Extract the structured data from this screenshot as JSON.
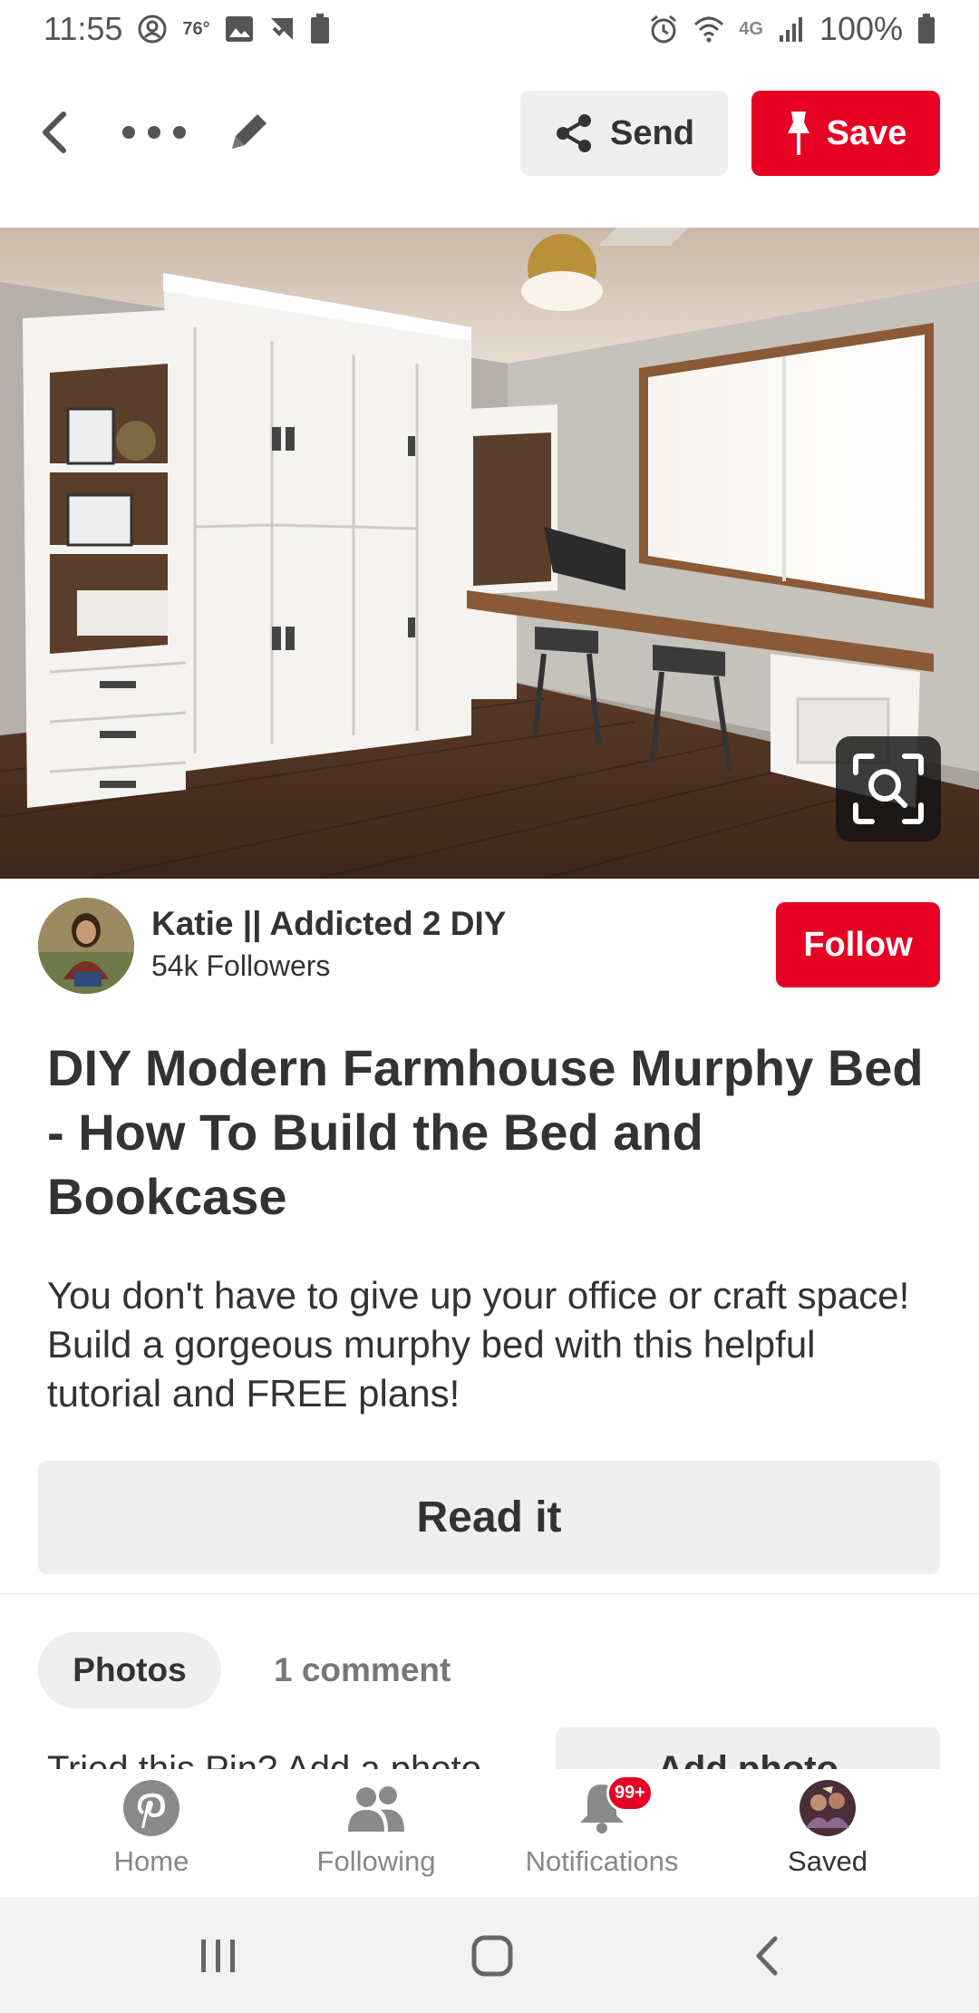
{
  "status_bar": {
    "time": "11:55",
    "temperature": "76°",
    "battery_small": "100",
    "network": "4G",
    "battery_percent": "100%"
  },
  "toolbar": {
    "send_label": "Send",
    "save_label": "Save"
  },
  "creator": {
    "name": "Katie || Addicted 2 DIY",
    "followers": "54k Followers",
    "follow_label": "Follow"
  },
  "pin": {
    "title": "DIY Modern Farmhouse Murphy Bed - How To Build the Bed and Bookcase",
    "description": "You don't have to give up your office or craft space! Build a gorgeous murphy bed with this helpful tutorial and FREE plans!",
    "read_label": "Read it"
  },
  "tabs": {
    "photos_label": "Photos",
    "comments_label": "1 comment"
  },
  "tried": {
    "prompt": "Tried this Pin? Add a photo",
    "add_photo_label": "Add photo"
  },
  "bottom_nav": {
    "items": [
      {
        "label": "Home",
        "icon": "pinterest-logo-icon"
      },
      {
        "label": "Following",
        "icon": "people-icon"
      },
      {
        "label": "Notifications",
        "icon": "bell-icon",
        "badge": "99+"
      },
      {
        "label": "Saved",
        "icon": "profile-avatar"
      }
    ]
  },
  "colors": {
    "brand_red": "#e60023",
    "button_gray": "#efefef"
  }
}
